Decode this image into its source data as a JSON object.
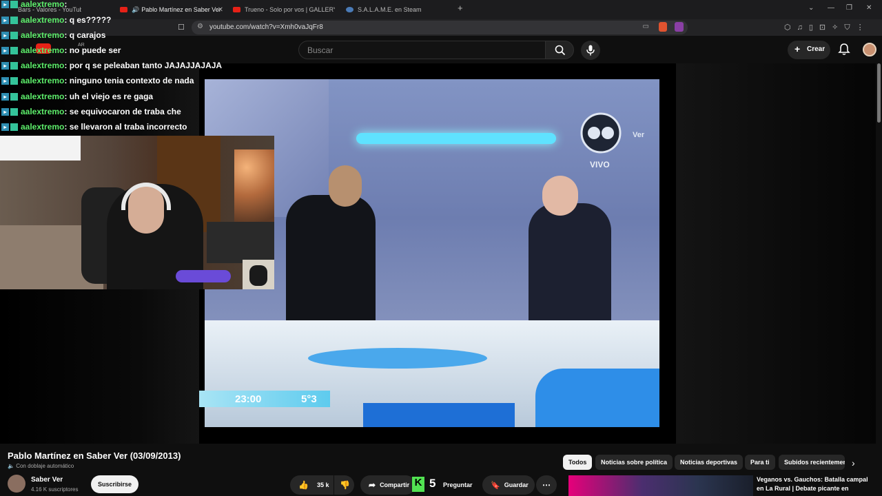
{
  "browser": {
    "tabs": [
      {
        "label": "Bars - Valores - YouTube"
      },
      {
        "label": "Pablo Martínez en Saber Ver"
      },
      {
        "label": "Trueno - Solo por vos | GALLERY SES"
      },
      {
        "label": "S.A.L.A.M.E. en Steam"
      }
    ],
    "url": "youtube.com/watch?v=Xmh0vaJqFr8"
  },
  "youtube": {
    "search_placeholder": "Buscar",
    "create_label": "Crear",
    "country": "AR"
  },
  "chat": {
    "messages": [
      {
        "user": "aalextremo",
        "text": ": "
      },
      {
        "user": "aalextremo",
        "text": ": q es?????"
      },
      {
        "user": "aalextremo",
        "text": ": q carajos"
      },
      {
        "user": "aalextremo",
        "text": ": no puede ser"
      },
      {
        "user": "aalextremo",
        "text": ": por q se peleaban tanto JAJAJJAJAJA"
      },
      {
        "user": "aalextremo",
        "text": ": ninguno tenia contexto de nada"
      },
      {
        "user": "aalextremo",
        "text": ": uh el viejo es re gaga"
      },
      {
        "user": "aalextremo",
        "text": ": se equivocaron de traba che"
      },
      {
        "user": "aalextremo",
        "text": ": se llevaron al traba incorrecto"
      }
    ]
  },
  "video_overlay": {
    "time": "23:00",
    "temp": "5°3",
    "live": "VIVO",
    "channel_logo": "SB Ver"
  },
  "video": {
    "title": "Pablo Martínez en Saber Ver (03/09/2013)",
    "dubbing": "Con doblaje automático",
    "channel": "Saber Ver",
    "subscribers": "4.16 K suscriptores",
    "subscribe_label": "Suscribirse",
    "likes": "35 k",
    "share_label": "Compartir",
    "ask_label": "Preguntar",
    "save_label": "Guardar",
    "stream_counter": "5"
  },
  "filters": [
    "Todos",
    "Noticias sobre política",
    "Noticias deportivas",
    "Para ti",
    "Subidos recientemente"
  ],
  "recommended": {
    "title": "Veganos vs. Gauchos: Batalla campal en La Rural | Debate picante en"
  }
}
